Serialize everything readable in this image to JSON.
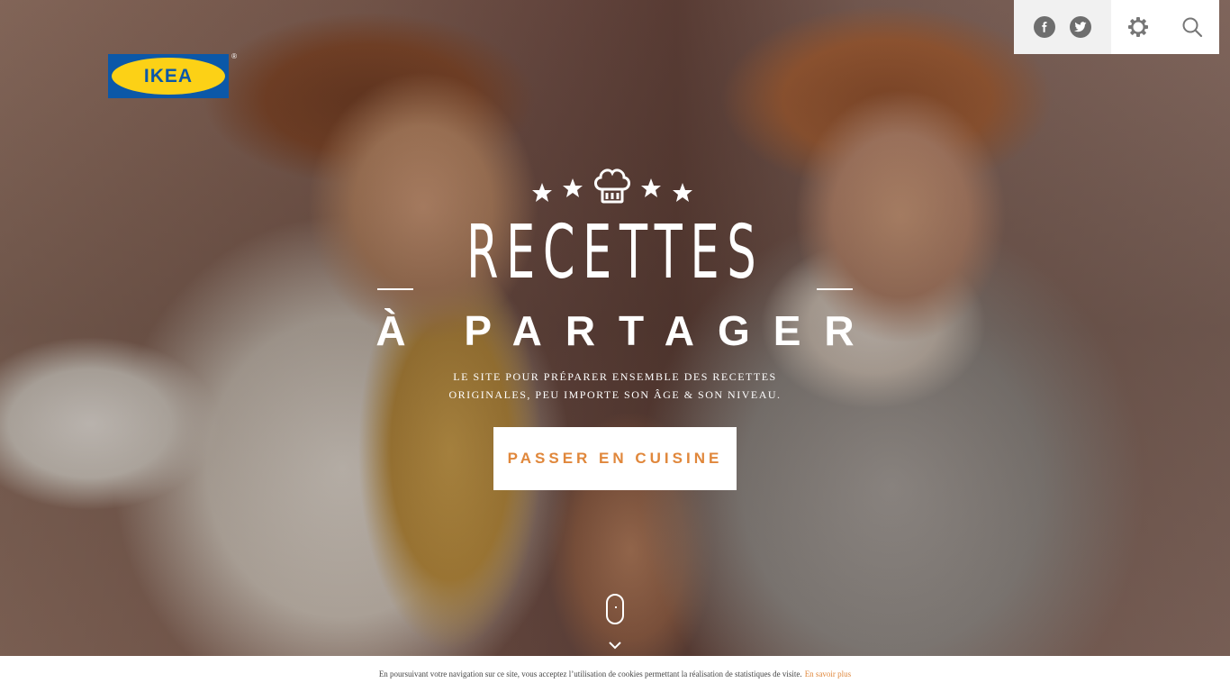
{
  "brand": {
    "logo_text": "IKEA",
    "logo_mark": "®",
    "colors": {
      "blue": "#0b58a8",
      "yellow": "#fcd116"
    }
  },
  "topbar": {
    "social": [
      {
        "icon": "facebook-icon",
        "glyph": "f"
      },
      {
        "icon": "twitter-icon",
        "glyph": "t"
      }
    ],
    "settings_icon": "gear-icon",
    "search_icon": "search-icon"
  },
  "hero": {
    "rating_icons": [
      "star-icon",
      "star-icon",
      "chef-hat-icon",
      "star-icon",
      "star-icon"
    ],
    "title": "RECETTES",
    "subtitle": "À PARTAGER",
    "tagline_line1": "LE SITE POUR PRÉPARER ENSEMBLE DES RECETTES",
    "tagline_line2": "ORIGINALES, PEU IMPORTE SON ÂGE & SON NIVEAU.",
    "cta_label": "PASSER EN CUISINE",
    "accent_color": "#e0873b"
  },
  "scroll_hint": {
    "icon": "scroll-mouse-icon",
    "arrow_icon": "chevron-down-icon"
  },
  "cookie_notice": {
    "text": "En poursuivant votre navigation sur ce site, vous acceptez l’utilisation de cookies permettant la réalisation de statistiques de visite.",
    "link_label": "En savoir plus"
  }
}
